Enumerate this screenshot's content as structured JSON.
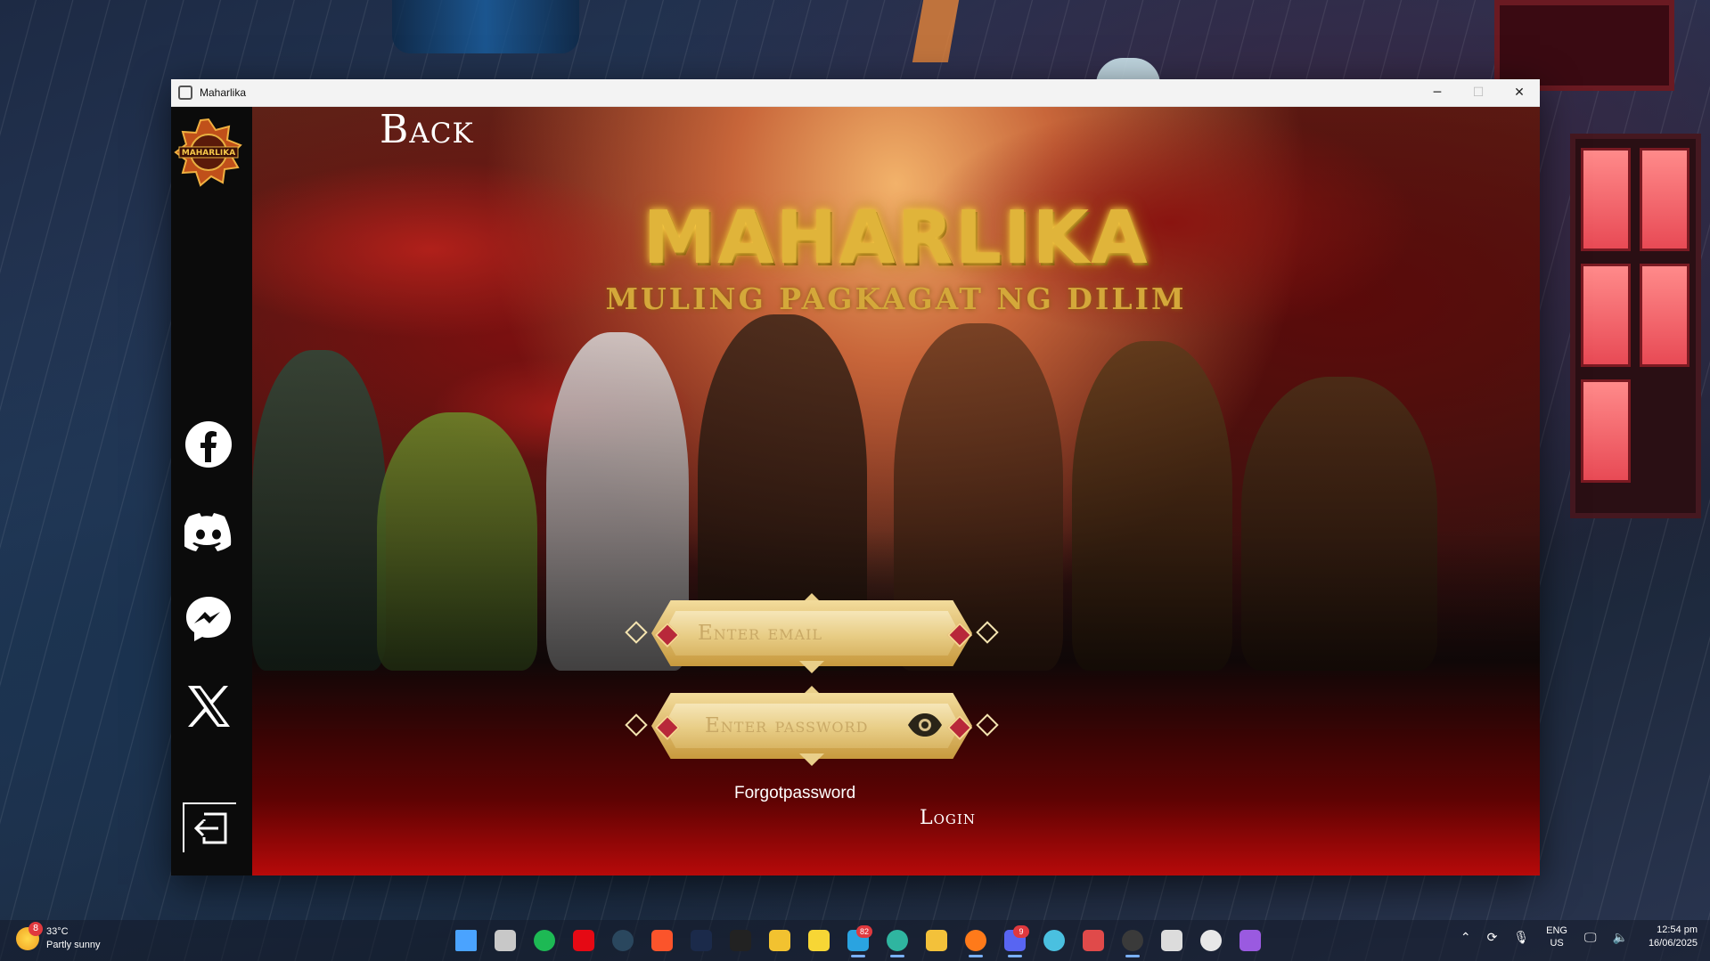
{
  "window": {
    "title": "Maharlika",
    "controls": {
      "minimize": "─",
      "maximize": "☐",
      "close": "✕"
    }
  },
  "sidebar": {
    "logo_text": "MAHARLIKA",
    "social": [
      "facebook-icon",
      "discord-icon",
      "messenger-icon",
      "x-icon"
    ],
    "exit_icon": "logout-icon"
  },
  "hero": {
    "back_label": "Back",
    "title": "MAHARLIKA",
    "subtitle": "MULING PAGKAGAT NG DILIM"
  },
  "form": {
    "email": {
      "placeholder": "Enter email",
      "value": ""
    },
    "password": {
      "placeholder": "Enter password",
      "value": ""
    },
    "forgot_label": "Forgotpassword",
    "login_label": "Login"
  },
  "taskbar": {
    "weather": {
      "temp": "33°C",
      "desc": "Partly sunny",
      "badge": "8"
    },
    "apps": [
      {
        "name": "start-icon",
        "color": "#4aa3ff"
      },
      {
        "name": "task-view-icon",
        "color": "#c8c8c8"
      },
      {
        "name": "spotify-icon",
        "color": "#1db954"
      },
      {
        "name": "netflix-icon",
        "color": "#e50914"
      },
      {
        "name": "steam-icon",
        "color": "#2a475e"
      },
      {
        "name": "brave-icon",
        "color": "#fb542b"
      },
      {
        "name": "app-dark-icon",
        "color": "#1b2a4a"
      },
      {
        "name": "capcut-icon",
        "color": "#222222"
      },
      {
        "name": "app-yellow-icon",
        "color": "#f2c230"
      },
      {
        "name": "sticky-notes-icon",
        "color": "#f7d635"
      },
      {
        "name": "telegram-icon",
        "color": "#2aa3e0"
      },
      {
        "name": "edge-icon",
        "color": "#2fb5a0"
      },
      {
        "name": "file-explorer-icon",
        "color": "#f3c13a"
      },
      {
        "name": "firefox-icon",
        "color": "#ff7a1a"
      },
      {
        "name": "discord-taskbar-icon",
        "color": "#5865f2"
      },
      {
        "name": "app-globe-icon",
        "color": "#4ac0e0"
      },
      {
        "name": "app-colorful-icon",
        "color": "#e04a4a"
      },
      {
        "name": "obs-icon",
        "color": "#3a3a3a"
      },
      {
        "name": "unity-icon",
        "color": "#dcdcdc"
      },
      {
        "name": "media-player-icon",
        "color": "#e8e8e8"
      },
      {
        "name": "app-purple-icon",
        "color": "#9a5ae0"
      }
    ],
    "telegram_badge": "82",
    "discord_badge": "9",
    "lang": {
      "line1": "ENG",
      "line2": "US"
    },
    "clock": {
      "time": "12:54 pm",
      "date": "16/06/2025"
    }
  }
}
